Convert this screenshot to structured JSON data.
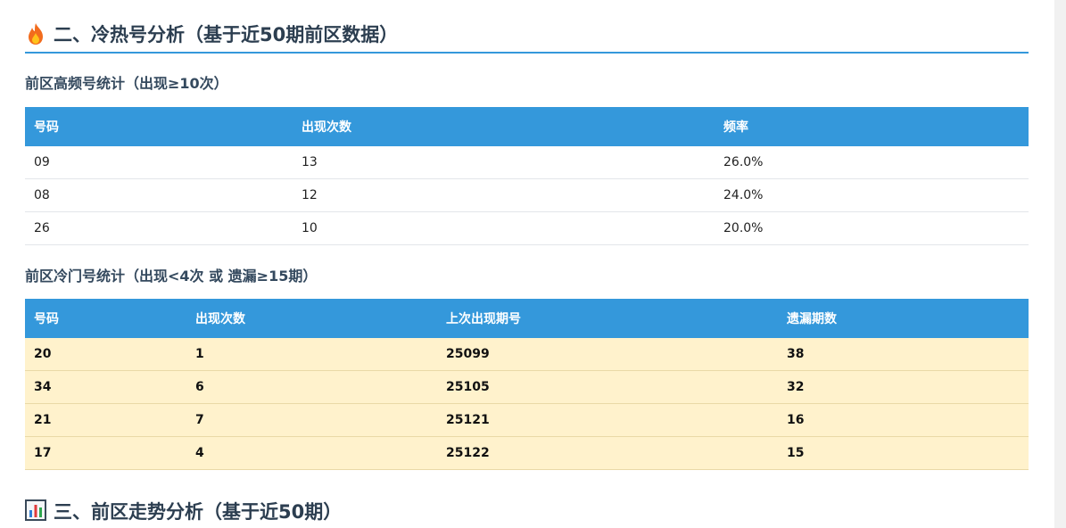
{
  "sections": {
    "cold_hot": {
      "icon": "fire-icon",
      "title": "二、冷热号分析（基于近50期前区数据）"
    },
    "trend": {
      "icon": "bar-chart-icon",
      "title": "三、前区走势分析（基于近50期）"
    }
  },
  "hot": {
    "subtitle": "前区高频号统计（出现≥10次）",
    "headers": [
      "号码",
      "出现次数",
      "频率"
    ],
    "rows": [
      [
        "09",
        "13",
        "26.0%"
      ],
      [
        "08",
        "12",
        "24.0%"
      ],
      [
        "26",
        "10",
        "20.0%"
      ]
    ]
  },
  "cold": {
    "subtitle": "前区冷门号统计（出现<4次 或 遗漏≥15期）",
    "headers": [
      "号码",
      "出现次数",
      "上次出现期号",
      "遗漏期数"
    ],
    "rows": [
      [
        "20",
        "1",
        "25099",
        "38"
      ],
      [
        "34",
        "6",
        "25105",
        "32"
      ],
      [
        "21",
        "7",
        "25121",
        "16"
      ],
      [
        "17",
        "4",
        "25122",
        "15"
      ]
    ]
  },
  "colors": {
    "accent": "#3498db",
    "cold_row_bg": "#fff2cc",
    "title": "#2c3e50"
  }
}
